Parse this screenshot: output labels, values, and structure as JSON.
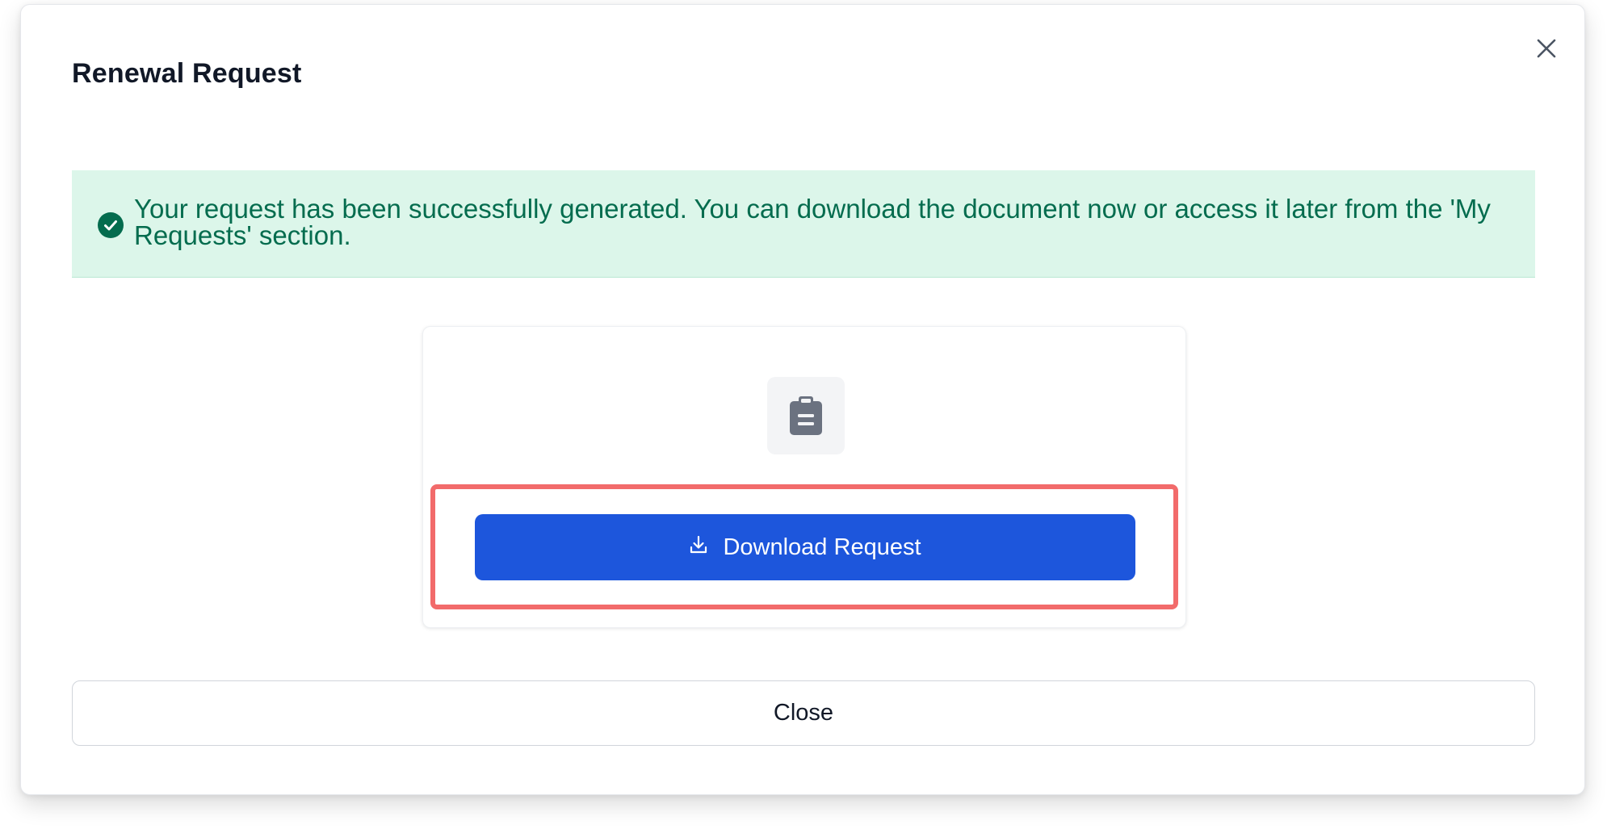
{
  "modal": {
    "title": "Renewal Request",
    "close_icon": "close-icon"
  },
  "alert": {
    "icon": "check-circle-icon",
    "message": "Your request has been successfully generated. You can download the document now or access it later from the 'My Requests' section.",
    "color": "#046c4e",
    "background": "#dcf6ea"
  },
  "card": {
    "icon": "clipboard-icon",
    "download_button": {
      "icon": "download-icon",
      "label": "Download Request",
      "color": "#1d56dc"
    },
    "highlight_color": "#f26b6b"
  },
  "footer": {
    "close_label": "Close"
  }
}
